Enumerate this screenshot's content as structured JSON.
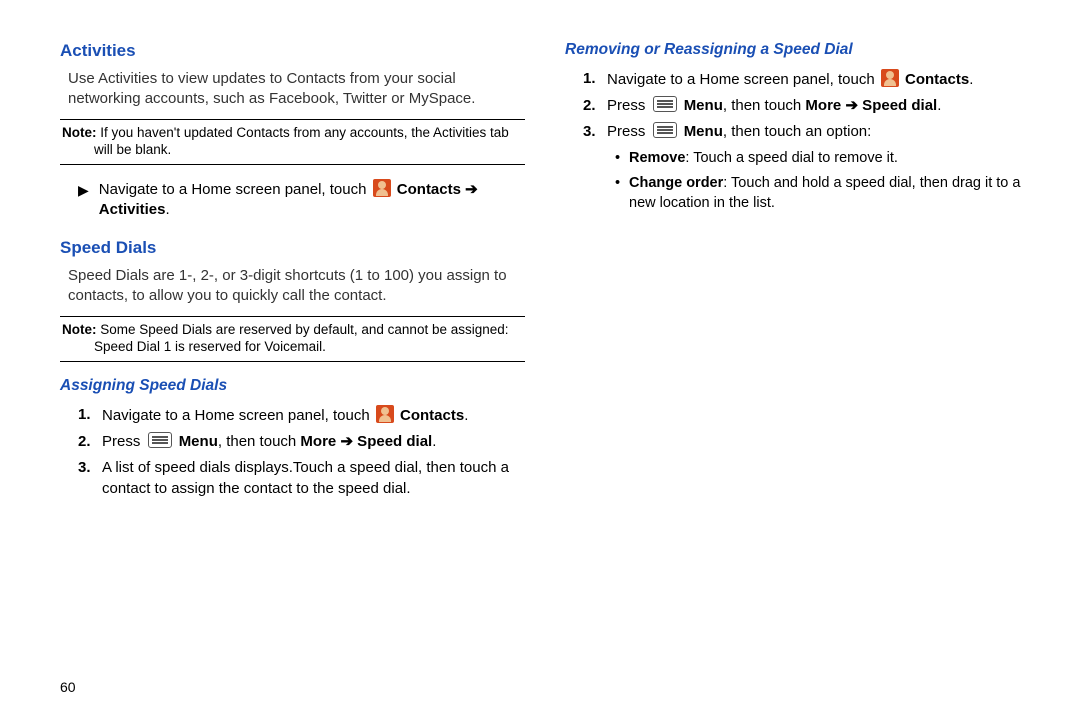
{
  "page_number": "60",
  "arrow_glyph": "➔",
  "left": {
    "h_activities": "Activities",
    "p_activities": "Use Activities to view updates to Contacts from your social networking accounts, such as Facebook, Twitter or MySpace.",
    "note1_label": "Note:",
    "note1_line1": " If you haven't updated Contacts from any accounts, the Activities tab",
    "note1_line2": "will be blank.",
    "nav_activities_pre": "Navigate to a Home screen panel, touch ",
    "contacts_label": " Contacts ",
    "activities_label": "Activities",
    "h_speed": "Speed Dials",
    "p_speed": "Speed Dials are 1-, 2-, or 3-digit shortcuts (1 to 100) you assign to contacts, to allow you to quickly call the contact.",
    "note2_label": "Note:",
    "note2_line1": " Some Speed Dials are reserved by default, and cannot be assigned:",
    "note2_line2": "Speed Dial 1 is reserved for Voicemail.",
    "h_assign": "Assigning Speed Dials",
    "assign1_pre": "Navigate to a Home screen panel, touch ",
    "assign1_contacts": " Contacts",
    "assign2_pre": "Press ",
    "assign2_menu": " Menu",
    "assign2_mid": ", then touch ",
    "assign2_more": "More ",
    "assign2_speed": " Speed dial",
    "assign3": "A list of speed dials displays.Touch a speed dial, then touch a contact to assign the contact to the speed dial."
  },
  "right": {
    "h_remove": "Removing or Reassigning a Speed Dial",
    "r1_pre": "Navigate to a Home screen panel, touch ",
    "r1_contacts": " Contacts",
    "r2_pre": "Press ",
    "r2_menu": " Menu",
    "r2_mid": ", then touch ",
    "r2_more": "More ",
    "r2_speed": " Speed dial",
    "r3_pre": "Press ",
    "r3_menu": " Menu",
    "r3_post": ", then touch an option:",
    "b1_label": "Remove",
    "b1_text": ": Touch a speed dial to remove it.",
    "b2_label": "Change order",
    "b2_text": ": Touch and hold a speed dial, then drag it to a new location in the list."
  }
}
